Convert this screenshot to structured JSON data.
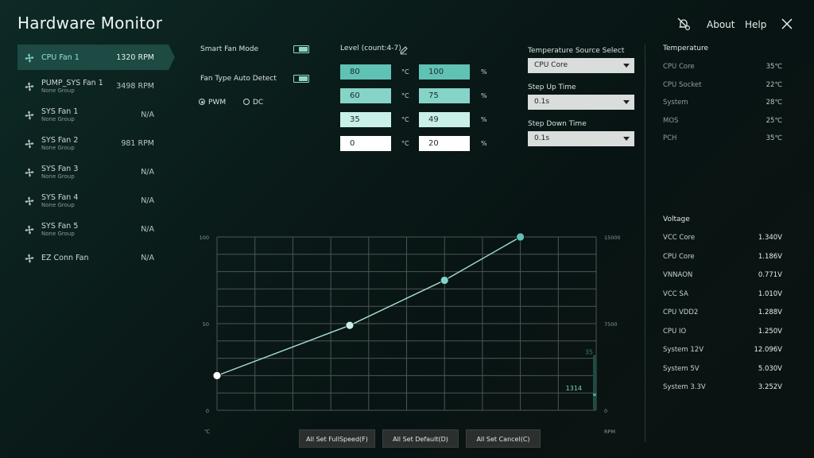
{
  "app": {
    "title": "Hardware Monitor",
    "about": "About",
    "help": "Help"
  },
  "icons": {
    "notify": "bell-slash-gear-icon",
    "close": "close-icon",
    "fan": "fan-icon",
    "edit": "pencil-icon"
  },
  "accent": "#7fd3c5",
  "fans": [
    {
      "name": "CPU Fan 1",
      "group": "",
      "rpm": "1320 RPM",
      "active": true
    },
    {
      "name": "PUMP_SYS Fan 1",
      "group": "None Group",
      "rpm": "3498 RPM"
    },
    {
      "name": "SYS Fan 1",
      "group": "None Group",
      "rpm": "N/A"
    },
    {
      "name": "SYS Fan 2",
      "group": "None Group",
      "rpm": "981 RPM"
    },
    {
      "name": "SYS Fan 3",
      "group": "None Group",
      "rpm": "N/A"
    },
    {
      "name": "SYS Fan 4",
      "group": "None Group",
      "rpm": "N/A"
    },
    {
      "name": "SYS Fan 5",
      "group": "None Group",
      "rpm": "N/A"
    },
    {
      "name": "EZ Conn Fan",
      "group": "",
      "rpm": "N/A"
    }
  ],
  "settings": {
    "smart_fan_mode": "Smart Fan Mode",
    "fan_type_auto": "Fan Type Auto Detect",
    "pwm": "PWM",
    "dc": "DC",
    "level_label": "Level (count:4-7)",
    "deg_unit": "°C",
    "pct_unit": "%",
    "levels": [
      {
        "temp": "80",
        "pct": "100"
      },
      {
        "temp": "60",
        "pct": "75"
      },
      {
        "temp": "35",
        "pct": "49"
      },
      {
        "temp": "0",
        "pct": "20"
      }
    ],
    "temp_source_label": "Temperature Source Select",
    "temp_source_value": "CPU Core",
    "step_up_label": "Step Up Time",
    "step_up_value": "0.1s",
    "step_down_label": "Step Down Time",
    "step_down_value": "0.1s"
  },
  "temperature": {
    "title": "Temperature",
    "rows": [
      {
        "name": "CPU Core",
        "value": "35℃"
      },
      {
        "name": "CPU Socket",
        "value": "22℃"
      },
      {
        "name": "System",
        "value": "28℃"
      },
      {
        "name": "MOS",
        "value": "25℃"
      },
      {
        "name": "PCH",
        "value": "35℃"
      }
    ]
  },
  "voltage": {
    "title": "Voltage",
    "rows": [
      {
        "name": "VCC Core",
        "value": "1.340V"
      },
      {
        "name": "CPU Core",
        "value": "1.186V"
      },
      {
        "name": "VNNAON",
        "value": "0.771V"
      },
      {
        "name": "VCC SA",
        "value": "1.010V"
      },
      {
        "name": "CPU VDD2",
        "value": "1.288V"
      },
      {
        "name": "CPU IO",
        "value": "1.250V"
      },
      {
        "name": "System 12V",
        "value": "12.096V"
      },
      {
        "name": "System 5V",
        "value": "5.030V"
      },
      {
        "name": "System 3.3V",
        "value": "3.252V"
      }
    ]
  },
  "chart_data": {
    "type": "line",
    "x": [
      0,
      35,
      60,
      80
    ],
    "y": [
      20,
      49,
      75,
      100
    ],
    "xlim": [
      0,
      100
    ],
    "ylim": [
      0,
      100
    ],
    "y_ticks": [
      "100",
      "50",
      "0"
    ],
    "y2_ticks": [
      "15000",
      "7500",
      "0"
    ],
    "x_unit": "℃",
    "y2_unit": "RPM",
    "current_temp_label": "35",
    "current_rpm_label": "1314",
    "current_temp": 35,
    "current_rpm": 1314,
    "y2_max": 15000
  },
  "buttons": {
    "full_speed": "All Set FullSpeed(F)",
    "default": "All Set Default(D)",
    "cancel": "All Set Cancel(C)"
  }
}
